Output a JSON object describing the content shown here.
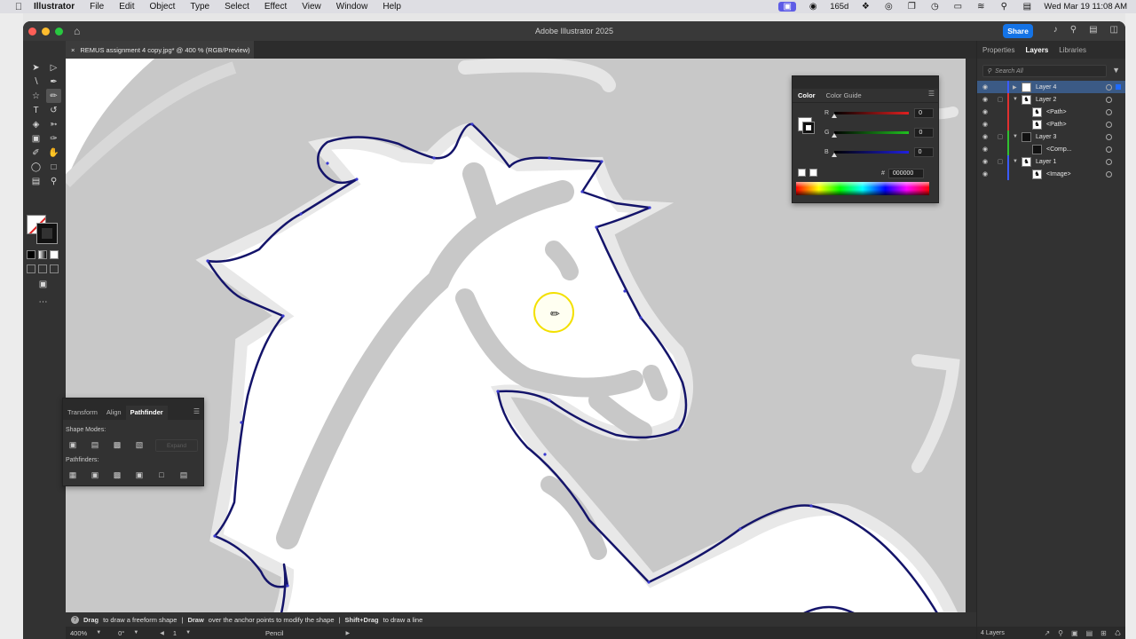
{
  "menubar": {
    "app_name": "Illustrator",
    "items": [
      "File",
      "Edit",
      "Object",
      "Type",
      "Select",
      "Effect",
      "View",
      "Window",
      "Help"
    ],
    "status_count": "165d",
    "datetime": "Wed Mar 19  11:08 AM"
  },
  "window": {
    "title": "Adobe Illustrator 2025",
    "share_label": "Share",
    "doc_tab": "REMUS assignment 4 copy.jpg* @ 400 % (RGB/Preview)"
  },
  "hint": {
    "part1_bold": "Drag",
    "part1": "to draw a freeform shape",
    "part2_bold": "Draw",
    "part2": "over the anchor points to modify the shape",
    "part3_bold": "Shift+Drag",
    "part3": "to draw a line"
  },
  "status": {
    "zoom": "400%",
    "rotation": "0°",
    "artboard": "1",
    "tool": "Pencil"
  },
  "color_panel": {
    "tabs": [
      "Color",
      "Color Guide"
    ],
    "r_label": "R",
    "r_value": "0",
    "g_label": "G",
    "g_value": "0",
    "b_label": "B",
    "b_value": "0",
    "hex_symbol": "#",
    "hex_value": "000000",
    "colors": {
      "red": "#e02020",
      "green": "#20c020",
      "blue": "#2020e0"
    }
  },
  "pathfinder_panel": {
    "tabs": [
      "Transform",
      "Align",
      "Pathfinder"
    ],
    "shape_modes_label": "Shape Modes:",
    "expand_label": "Expand",
    "pathfinders_label": "Pathfinders:"
  },
  "right_panel": {
    "tabs": [
      "Properties",
      "Layers",
      "Libraries"
    ],
    "search_placeholder": "Search All",
    "layers": [
      {
        "name": "Layer 4",
        "color": "#3b5bff"
      },
      {
        "name": "Layer 2",
        "color": "#e03030"
      },
      {
        "name": "<Path>",
        "color": "#e03030"
      },
      {
        "name": "<Path>",
        "color": "#e03030"
      },
      {
        "name": "Layer 3",
        "color": "#30c030"
      },
      {
        "name": "<Comp...",
        "color": "#30c030"
      },
      {
        "name": "Layer 1",
        "color": "#3b5bff"
      },
      {
        "name": "<Image>",
        "color": "#3b5bff"
      }
    ],
    "footer_count": "4 Layers"
  },
  "canvas": {
    "outline_color": "#14146a",
    "background_color": "#c8c8c8",
    "cursor_highlight": "#f3e000"
  }
}
